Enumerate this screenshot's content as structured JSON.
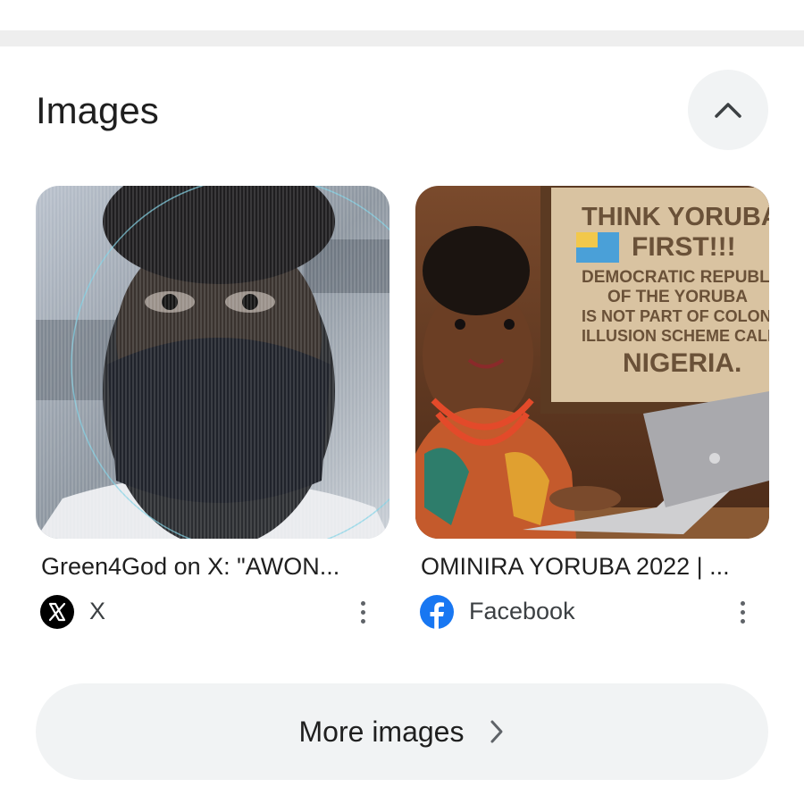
{
  "section": {
    "title": "Images"
  },
  "cards": [
    {
      "caption": "Green4God on X: \"AWON...",
      "source": {
        "name": "X",
        "icon": "x-logo-icon"
      }
    },
    {
      "caption": "OMINIRA YORUBA 2022 | ...",
      "source": {
        "name": "Facebook",
        "icon": "facebook-logo-icon"
      },
      "sign_text": [
        "THINK YORUBA",
        "FIRST!!!",
        "DEMOCRATIC REPUBLIC",
        "OF THE YORUBA",
        "IS NOT PART OF COLONIAL",
        "ILLUSION SCHEME CALLED",
        "NIGERIA."
      ]
    }
  ],
  "more_button": {
    "label": "More images"
  },
  "colors": {
    "chip_bg": "#f1f3f4",
    "facebook_blue": "#1877f2",
    "x_black": "#000000",
    "text": "#1f1f1f"
  }
}
